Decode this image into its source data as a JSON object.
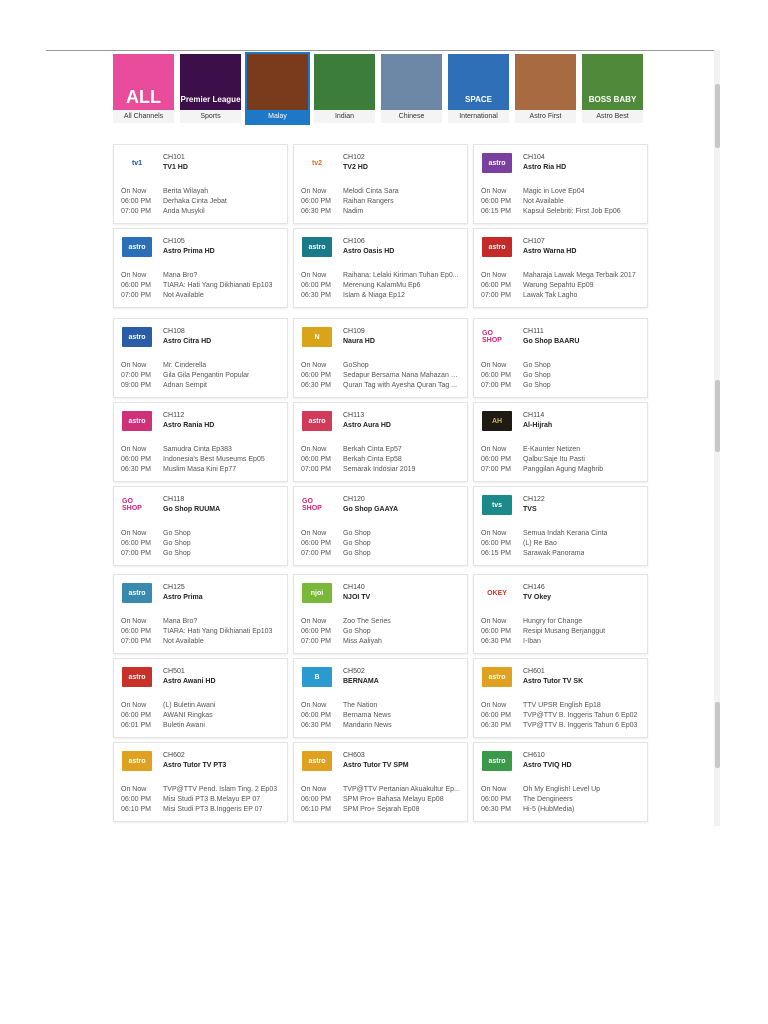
{
  "categories": [
    {
      "label": "All Channels",
      "thumb_text": "ALL",
      "color": "#e84c9a",
      "selected": false
    },
    {
      "label": "Sports",
      "thumb_text": "Premier League",
      "color": "#3d0f4a",
      "selected": false
    },
    {
      "label": "Malay",
      "thumb_text": "",
      "color": "#7a3a1c",
      "selected": true
    },
    {
      "label": "Indian",
      "thumb_text": "",
      "color": "#3c7d3a",
      "selected": false
    },
    {
      "label": "Chinese",
      "thumb_text": "",
      "color": "#6d87a6",
      "selected": false
    },
    {
      "label": "International",
      "thumb_text": "SPACE",
      "color": "#2f6fb8",
      "selected": false
    },
    {
      "label": "Astro First",
      "thumb_text": "",
      "color": "#a86a40",
      "selected": false
    },
    {
      "label": "Astro Best",
      "thumb_text": "BOSS BABY",
      "color": "#4e8a3a",
      "selected": false
    }
  ],
  "sections": [
    [
      {
        "ch": "CH101",
        "name": "TV1 HD",
        "logo": "tv1",
        "lc": "#ffffff",
        "lt": "#1d4fa0",
        "rows": [
          [
            "On Now",
            "Berita Wilayah"
          ],
          [
            "06:00 PM",
            "Derhaka Cinta Jebat"
          ],
          [
            "07:00 PM",
            "Anda Musykil"
          ]
        ]
      },
      {
        "ch": "CH102",
        "name": "TV2 HD",
        "logo": "tv2",
        "lc": "#ffffff",
        "lt": "#e06a1e",
        "rows": [
          [
            "On Now",
            "Melodi Cinta Sara"
          ],
          [
            "06:00 PM",
            "Raihan Rangers"
          ],
          [
            "06:30 PM",
            "Nadim"
          ]
        ]
      },
      {
        "ch": "CH104",
        "name": "Astro Ria HD",
        "logo": "astro",
        "lc": "#7b3fa0",
        "lt": "#ffffff",
        "rows": [
          [
            "On Now",
            "Magic in Love Ep04"
          ],
          [
            "06:00 PM",
            "Not Available"
          ],
          [
            "06:15 PM",
            "Kapsul Selebriti: First Job Ep06"
          ]
        ]
      },
      {
        "ch": "CH105",
        "name": "Astro Prima HD",
        "logo": "astro",
        "lc": "#2a6fb8",
        "lt": "#ffffff",
        "rows": [
          [
            "On Now",
            "Mana Bro?"
          ],
          [
            "06:00 PM",
            "TIARA: Hati Yang Dikhianati Ep103"
          ],
          [
            "07:00 PM",
            "Not Available"
          ]
        ]
      },
      {
        "ch": "CH106",
        "name": "Astro Oasis HD",
        "logo": "astro",
        "lc": "#1a7a8a",
        "lt": "#ffffff",
        "rows": [
          [
            "On Now",
            "Raihana: Lelaki Kiriman Tuhan Ep0..."
          ],
          [
            "06:00 PM",
            "Merenung KalamMu Ep6"
          ],
          [
            "06:30 PM",
            "Islam & Niaga Ep12"
          ]
        ]
      },
      {
        "ch": "CH107",
        "name": "Astro Warna HD",
        "logo": "astro",
        "lc": "#c42a2a",
        "lt": "#ffffff",
        "rows": [
          [
            "On Now",
            "Maharaja Lawak Mega Terbaik 2017"
          ],
          [
            "06:00 PM",
            "Warung Sepahtu Ep09"
          ],
          [
            "07:00 PM",
            "Lawak Tak Lagho"
          ]
        ]
      }
    ],
    [
      {
        "ch": "CH108",
        "name": "Astro Citra HD",
        "logo": "astro",
        "lc": "#2a5ca8",
        "lt": "#ffffff",
        "rows": [
          [
            "On Now",
            "Mr. Cinderella"
          ],
          [
            "07:00 PM",
            "Gila Gila Pengantin Popular"
          ],
          [
            "09:00 PM",
            "Adnan Sempit"
          ]
        ]
      },
      {
        "ch": "CH109",
        "name": "Naura HD",
        "logo": "N",
        "lc": "#d9a31a",
        "lt": "#ffffff",
        "rows": [
          [
            "On Now",
            "GoShop"
          ],
          [
            "06:00 PM",
            "Sedapur Bersama Nana Mahazan E..."
          ],
          [
            "06:30 PM",
            "Quran Tag with Ayesha Quran Tag ..."
          ]
        ]
      },
      {
        "ch": "CH111",
        "name": "Go Shop BAARU",
        "logo": "GO SHOP",
        "lc": "#ffffff",
        "lt": "#d0267a",
        "rows": [
          [
            "On Now",
            "Go Shop"
          ],
          [
            "06:00 PM",
            "Go Shop"
          ],
          [
            "07:00 PM",
            "Go Shop"
          ]
        ]
      },
      {
        "ch": "CH112",
        "name": "Astro Rania HD",
        "logo": "astro",
        "lc": "#d0307a",
        "lt": "#ffffff",
        "rows": [
          [
            "On Now",
            "Samudra Cinta Ep383"
          ],
          [
            "06:00 PM",
            "Indonesia's Best Museums Ep05"
          ],
          [
            "06:30 PM",
            "Muslim Masa Kini Ep77"
          ]
        ]
      },
      {
        "ch": "CH113",
        "name": "Astro Aura HD",
        "logo": "astro",
        "lc": "#d23a5a",
        "lt": "#ffffff",
        "rows": [
          [
            "On Now",
            "Berkah Cinta Ep57"
          ],
          [
            "06:00 PM",
            "Berkah Cinta Ep58"
          ],
          [
            "07:00 PM",
            "Semarak Indosiar 2019"
          ]
        ]
      },
      {
        "ch": "CH114",
        "name": "Al-Hijrah",
        "logo": "AH",
        "lc": "#1e1a14",
        "lt": "#d4b060",
        "rows": [
          [
            "On Now",
            "E-Kaunter Netizen"
          ],
          [
            "06:00 PM",
            "Qalbu:Saje Itu Pasti"
          ],
          [
            "07:00 PM",
            "Panggilan Agung Maghrib"
          ]
        ]
      },
      {
        "ch": "CH118",
        "name": "Go Shop RUUMA",
        "logo": "GO SHOP",
        "lc": "#ffffff",
        "lt": "#d0267a",
        "rows": [
          [
            "On Now",
            "Go Shop"
          ],
          [
            "06:00 PM",
            "Go Shop"
          ],
          [
            "07:00 PM",
            "Go Shop"
          ]
        ]
      },
      {
        "ch": "CH120",
        "name": "Go Shop GAAYA",
        "logo": "GO SHOP",
        "lc": "#ffffff",
        "lt": "#d0267a",
        "rows": [
          [
            "On Now",
            "Go Shop"
          ],
          [
            "06:00 PM",
            "Go Shop"
          ],
          [
            "07:00 PM",
            "Go Shop"
          ]
        ]
      },
      {
        "ch": "CH122",
        "name": "TVS",
        "logo": "tvs",
        "lc": "#1a8a8a",
        "lt": "#ffffff",
        "rows": [
          [
            "On Now",
            "Semua Indah Kerana Cinta"
          ],
          [
            "06:00 PM",
            "(L) Re Bao"
          ],
          [
            "06:15 PM",
            "Sarawak Panorama"
          ]
        ]
      }
    ],
    [
      {
        "ch": "CH125",
        "name": "Astro Prima",
        "logo": "astro",
        "lc": "#3a8ab0",
        "lt": "#ffffff",
        "rows": [
          [
            "On Now",
            "Mana Bro?"
          ],
          [
            "06:00 PM",
            "TIARA: Hati Yang Dikhianati Ep103"
          ],
          [
            "07:00 PM",
            "Not Available"
          ]
        ]
      },
      {
        "ch": "CH140",
        "name": "NJOI TV",
        "logo": "njoi",
        "lc": "#7ab83a",
        "lt": "#ffffff",
        "rows": [
          [
            "On Now",
            "Zoo The Series"
          ],
          [
            "06:00 PM",
            "Go Shop"
          ],
          [
            "07:00 PM",
            "Miss Aaliyah"
          ]
        ]
      },
      {
        "ch": "CH146",
        "name": "TV Okey",
        "logo": "OKEY",
        "lc": "#ffffff",
        "lt": "#d23a2a",
        "rows": [
          [
            "On Now",
            "Hungry for Change"
          ],
          [
            "06:00 PM",
            "Resipi Musang Berjanggut"
          ],
          [
            "06:30 PM",
            "I-Iban"
          ]
        ]
      },
      {
        "ch": "CH501",
        "name": "Astro Awani HD",
        "logo": "astro",
        "lc": "#c8302a",
        "lt": "#ffffff",
        "rows": [
          [
            "On Now",
            "(L) Buletin Awani"
          ],
          [
            "06:00 PM",
            "AWANI Ringkas"
          ],
          [
            "06:01 PM",
            "Buletin Awani"
          ]
        ]
      },
      {
        "ch": "CH502",
        "name": "BERNAMA",
        "logo": "B",
        "lc": "#2a9ad0",
        "lt": "#ffffff",
        "rows": [
          [
            "On Now",
            "The Nation"
          ],
          [
            "06:00 PM",
            "Bernama News"
          ],
          [
            "06:30 PM",
            "Mandarin News"
          ]
        ]
      },
      {
        "ch": "CH601",
        "name": "Astro Tutor TV SK",
        "logo": "astro",
        "lc": "#e0a020",
        "lt": "#ffffff",
        "rows": [
          [
            "On Now",
            "TTV UPSR English Ep18"
          ],
          [
            "06:00 PM",
            "TVP@TTV B. Inggeris Tahun 6 Ep02"
          ],
          [
            "06:30 PM",
            "TVP@TTV B. Inggeris Tahun 6 Ep03"
          ]
        ]
      },
      {
        "ch": "CH602",
        "name": "Astro Tutor TV PT3",
        "logo": "astro",
        "lc": "#e0a020",
        "lt": "#ffffff",
        "rows": [
          [
            "On Now",
            "TVP@TTV Pend. Islam Ting. 2 Ep03"
          ],
          [
            "06:00 PM",
            "Misi Studi PT3 B.Melayu EP 07"
          ],
          [
            "06:10 PM",
            "Misi Studi PT3 B.Inggeris EP 07"
          ]
        ]
      },
      {
        "ch": "CH603",
        "name": "Astro Tutor TV SPM",
        "logo": "astro",
        "lc": "#e0a020",
        "lt": "#ffffff",
        "rows": [
          [
            "On Now",
            "TVP@TTV Pertanian Akuakultur Ep..."
          ],
          [
            "06:00 PM",
            "SPM Pro+ Bahasa Melayu Ep08"
          ],
          [
            "06:10 PM",
            "SPM Pro+ Sejarah Ep08"
          ]
        ]
      },
      {
        "ch": "CH610",
        "name": "Astro TVIQ HD",
        "logo": "astro",
        "lc": "#3a9a4a",
        "lt": "#ffffff",
        "rows": [
          [
            "On Now",
            "Oh My English! Level Up"
          ],
          [
            "06:00 PM",
            "The Dengineers"
          ],
          [
            "06:30 PM",
            "Hi-5 (HubMedia)"
          ]
        ]
      }
    ]
  ]
}
